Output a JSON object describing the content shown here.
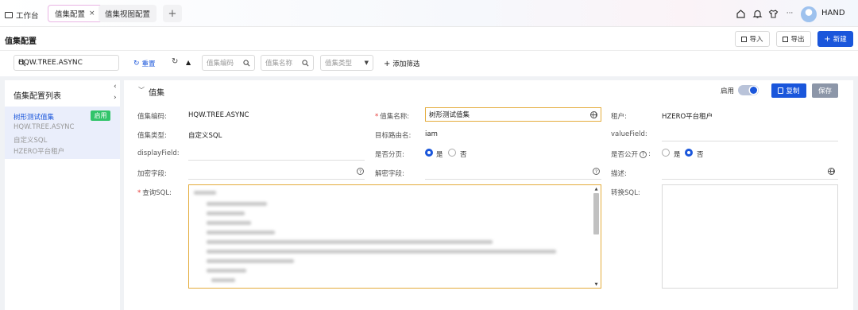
{
  "topbar": {
    "workbench_label": "工作台",
    "tabs": [
      {
        "label": "值集配置",
        "active": true,
        "close": "×"
      },
      {
        "label": "值集视图配置",
        "active": false
      }
    ],
    "add_tab": "+",
    "more": "···",
    "user_name": "HAND"
  },
  "header": {
    "title": "值集配置",
    "import_label": "导入",
    "export_label": "导出",
    "new_label": "新建"
  },
  "filter": {
    "search_value": "HQW.TREE.ASYNC",
    "reset_label": "重置",
    "code_placeholder": "值集编码",
    "name_placeholder": "值集名称",
    "type_placeholder": "值集类型",
    "add_filter_label": "添加筛选"
  },
  "list": {
    "title": "值集配置列表",
    "item": {
      "name": "树形测试值集",
      "code": "HQW.TREE.ASYNC",
      "type": "自定义SQL",
      "tenant": "HZERO平台租户",
      "status": "启用"
    }
  },
  "form": {
    "section_title": "值集",
    "enable_label": "启用",
    "enabled": true,
    "copy_label": "复制",
    "save_label": "保存",
    "fields": {
      "code_label": "值集编码:",
      "code_value": "HQW.TREE.ASYNC",
      "name_label": "值集名称:",
      "name_value": "树形测试值集",
      "tenant_label": "租户:",
      "tenant_value": "HZERO平台租户",
      "type_label": "值集类型:",
      "type_value": "自定义SQL",
      "route_label": "目标路由名:",
      "route_value": "iam",
      "value_field_label": "valueField:",
      "display_field_label": "displayField:",
      "paging_label": "是否分页:",
      "public_label": "是否公开",
      "yes": "是",
      "no": "否",
      "paging_value": "是",
      "public_value": "否",
      "encrypt_label": "加密字段:",
      "decrypt_label": "解密字段:",
      "desc_label": "描述:",
      "sql_label": "查询SQL:",
      "convert_sql_label": "转换SQL:"
    }
  },
  "colors": {
    "primary": "#1a56db",
    "success": "#31c46a",
    "required": "#e53935",
    "focus_border": "#e4ac3c"
  }
}
